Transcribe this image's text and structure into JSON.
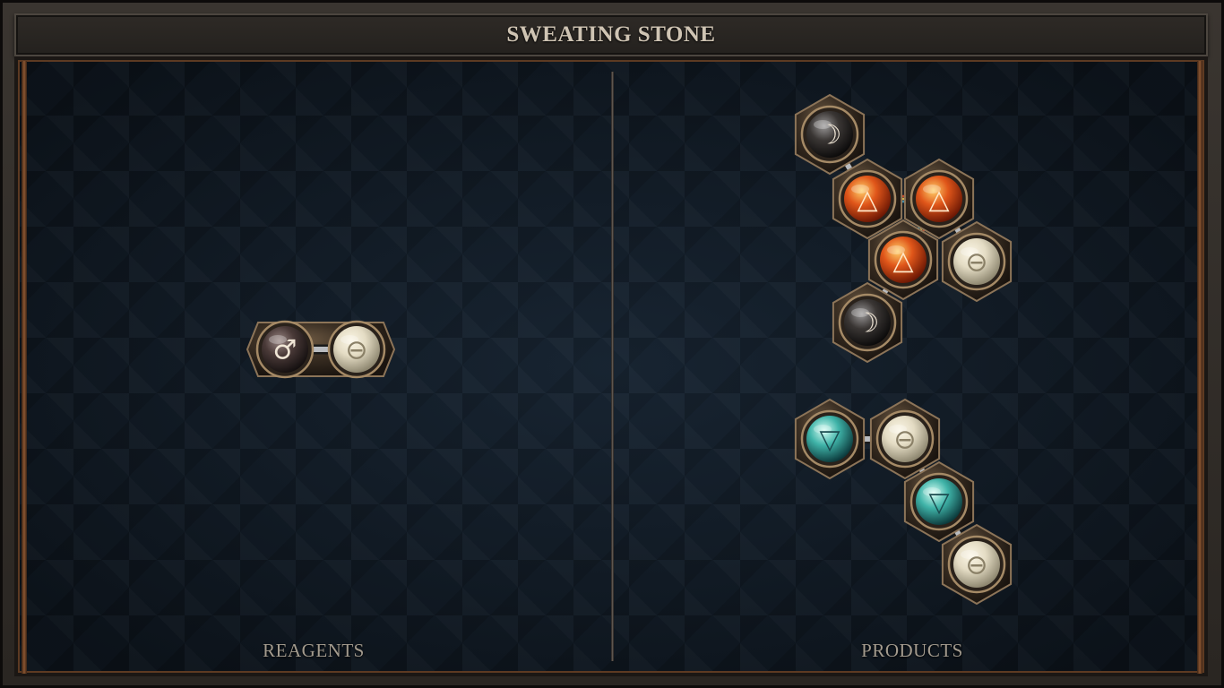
{
  "window": {
    "title": "SWEATING STONE"
  },
  "panels": {
    "reagents_label": "REAGENTS",
    "products_label": "PRODUCTS"
  },
  "colors": {
    "salt": "#e4dcc4",
    "fire": "#e0561a",
    "water": "#3fb3a8",
    "shadow": "#3a3634",
    "mars": "#4a3a38",
    "glyph_light": "#f0e6d6"
  },
  "atoms": {
    "mars": {
      "icon": "mars-icon",
      "symbol": "♂"
    },
    "salt": {
      "icon": "salt-icon",
      "symbol": "⊖"
    },
    "fire": {
      "icon": "fire-icon",
      "symbol": "△"
    },
    "water": {
      "icon": "water-icon",
      "symbol": "▽"
    },
    "shadow": {
      "icon": "moon-icon",
      "symbol": "☽"
    }
  },
  "molecules": {
    "reagent": [
      "mars",
      "salt"
    ],
    "product_1": [
      "shadow",
      "fire",
      "fire",
      "fire",
      "salt",
      "shadow"
    ],
    "product_2": [
      "water",
      "salt",
      "water",
      "salt"
    ]
  }
}
